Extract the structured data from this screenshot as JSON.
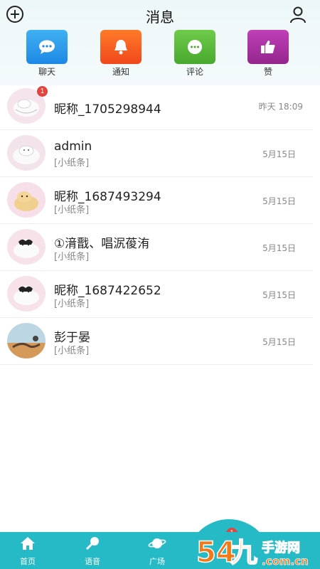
{
  "header": {
    "title": "消息"
  },
  "quick_actions": [
    {
      "label": "聊天",
      "icon": "chat-bubble-icon",
      "color": "#2196e8"
    },
    {
      "label": "通知",
      "icon": "bell-icon",
      "color": "#f25a1a"
    },
    {
      "label": "评论",
      "icon": "comment-icon",
      "color": "#55b83a"
    },
    {
      "label": "赞",
      "icon": "thumbs-up-icon",
      "color": "#a8309e"
    }
  ],
  "conversations": [
    {
      "name": "昵称_1705298944",
      "subtitle": "",
      "time": "昨天 18:09",
      "badge": "1"
    },
    {
      "name": "admin",
      "subtitle": "[小纸条]",
      "time": "5月15日",
      "badge": ""
    },
    {
      "name": "昵称_1687493294",
      "subtitle": "[小纸条]",
      "time": "5月15日",
      "badge": ""
    },
    {
      "name": "①湇戬、唱泦葰洧",
      "subtitle": "[小纸条]",
      "time": "5月15日",
      "badge": ""
    },
    {
      "name": "昵称_1687422652",
      "subtitle": "[小纸条]",
      "time": "5月15日",
      "badge": ""
    },
    {
      "name": "彭于晏",
      "subtitle": "[小纸条]",
      "time": "5月15日",
      "badge": ""
    }
  ],
  "tabbar": {
    "items": [
      {
        "label": "首页",
        "icon": "home-icon"
      },
      {
        "label": "语音",
        "icon": "microphone-icon"
      },
      {
        "label": "广场",
        "icon": "planet-icon"
      }
    ],
    "center_badge": "1",
    "color": "#26b9c6"
  },
  "watermark": {
    "text": "54九手游网",
    "sub": ".com.cn"
  }
}
